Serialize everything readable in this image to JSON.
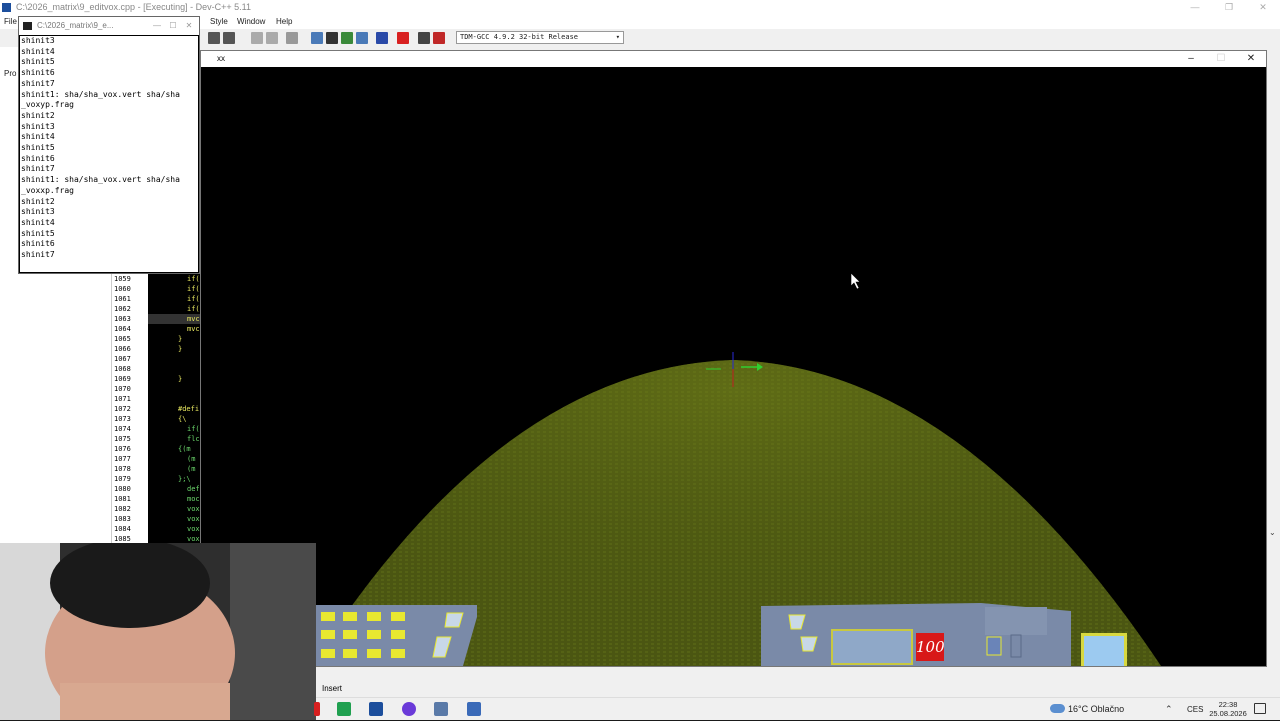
{
  "ide": {
    "title": "C:\\2026_matrix\\9_editvox.cpp - [Executing] - Dev-C++ 5.11",
    "menu": {
      "file": "File",
      "style": "Style",
      "window": "Window",
      "help": "Help"
    },
    "left_tab": "Pro",
    "compiler": "TDM-GCC 4.9.2 32-bit Release",
    "status_mode": "Insert",
    "line_numbers": [
      "1059",
      "1060",
      "1061",
      "1062",
      "1063",
      "1064",
      "1065",
      "1066",
      "1067",
      "1068",
      "1069",
      "1070",
      "1071",
      "1072",
      "1073",
      "1074",
      "1075",
      "1076",
      "1077",
      "1078",
      "1079",
      "1080",
      "1081",
      "1082",
      "1083",
      "1084",
      "1085"
    ],
    "code_lines": [
      "if(",
      "if(",
      "if(",
      "if(",
      "mvc",
      "mvc",
      "}",
      "}",
      "",
      "",
      "}",
      "",
      "",
      "#defi",
      "{\\",
      "if(",
      "flc",
      "{(m",
      "(m",
      "(m",
      "};\\",
      "def",
      "moc",
      "vox",
      "vox",
      "vox",
      "vox"
    ]
  },
  "console": {
    "title": "C:\\2026_matrix\\9_e...",
    "lines": [
      "shinit3",
      "shinit4",
      "shinit5",
      "shinit6",
      "shinit7",
      "shinit1: sha/sha_vox.vert sha/sha",
      "_voxyp.frag",
      "shinit2",
      "shinit3",
      "shinit4",
      "shinit5",
      "shinit6",
      "shinit7",
      "shinit1: sha/sha_vox.vert sha/sha",
      "_voxxp.frag",
      "shinit2",
      "shinit3",
      "shinit4",
      "shinit5",
      "shinit6",
      "shinit7"
    ]
  },
  "game": {
    "title": "xx",
    "hud_counter": "100",
    "colors": {
      "terrain": "#4f5a12",
      "terrain_light": "#6a7818",
      "hud_frame": "#c8c840",
      "counter_bg": "#d81818"
    }
  },
  "taskbar": {
    "weather": "16°C  Oblačno",
    "language": "CES",
    "time": "22:38",
    "date": "25.08.2026"
  }
}
